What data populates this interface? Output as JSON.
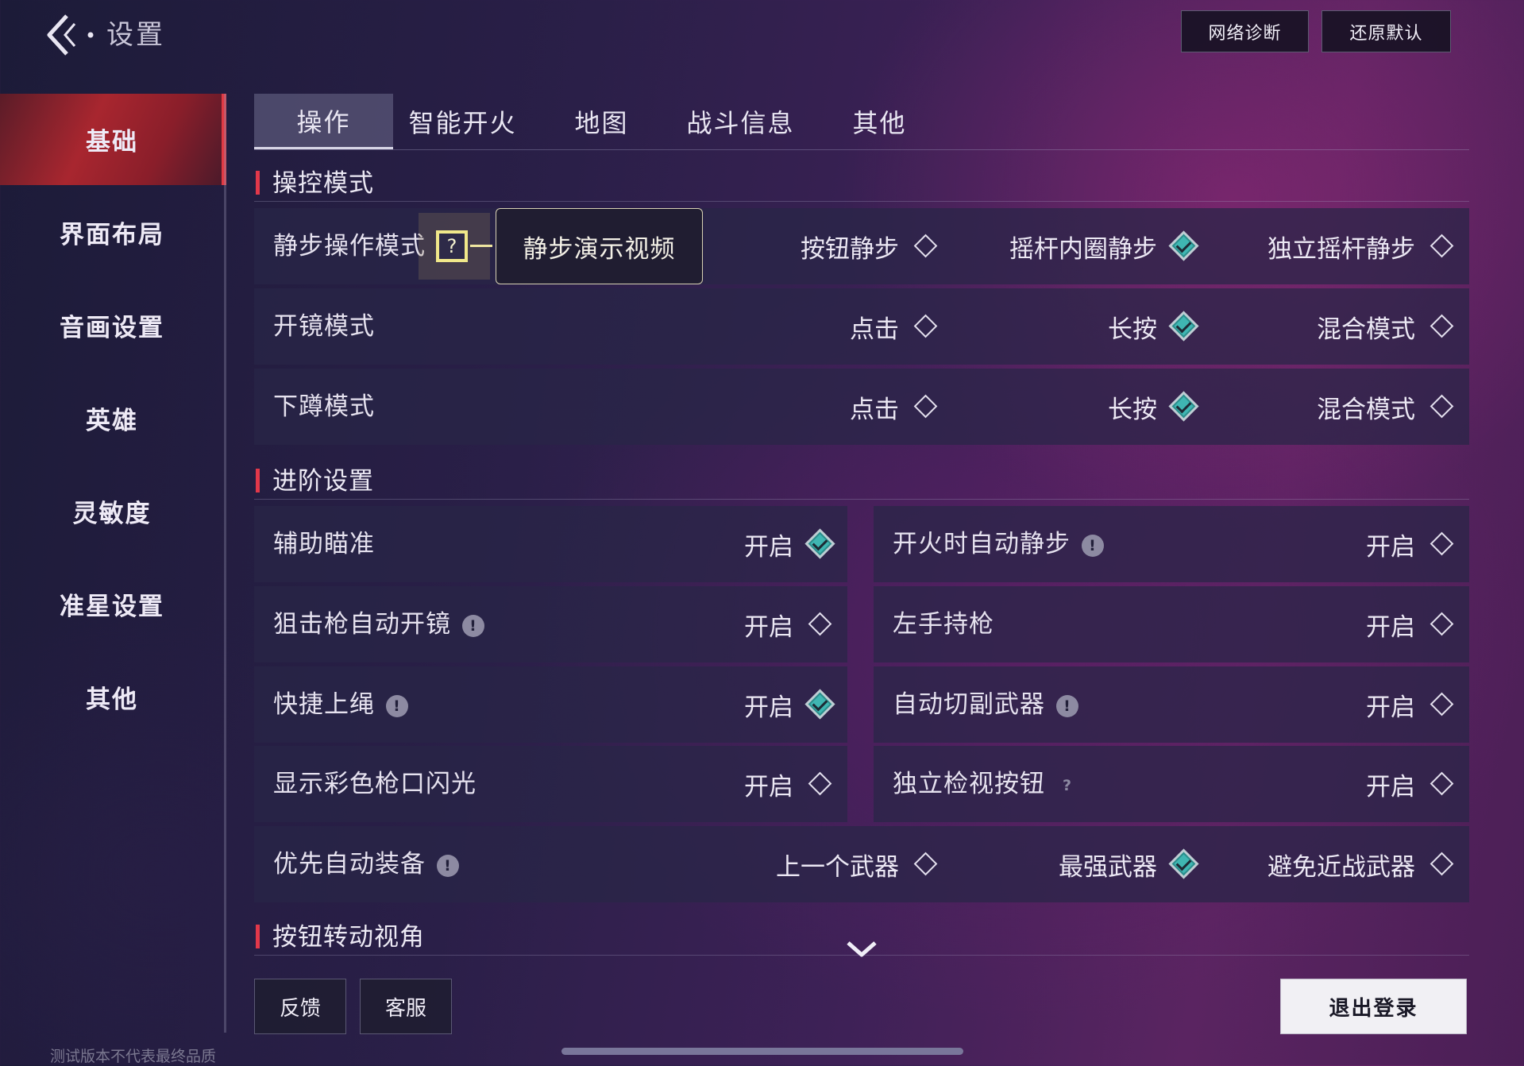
{
  "header": {
    "title": "设置",
    "network_button": "网络诊断",
    "reset_button": "还原默认"
  },
  "sidebar": {
    "items": [
      {
        "label": "基础",
        "active": true
      },
      {
        "label": "界面布局"
      },
      {
        "label": "音画设置"
      },
      {
        "label": "英雄"
      },
      {
        "label": "灵敏度"
      },
      {
        "label": "准星设置"
      },
      {
        "label": "其他"
      }
    ]
  },
  "tabs": [
    {
      "label": "操作",
      "active": true
    },
    {
      "label": "智能开火"
    },
    {
      "label": "地图"
    },
    {
      "label": "战斗信息"
    },
    {
      "label": "其他"
    }
  ],
  "control_mode": {
    "title": "操控模式",
    "rows": [
      {
        "label": "静步操作模式",
        "help": "?",
        "video_button": "静步演示视频",
        "options": [
          "按钮静步",
          "摇杆内圈静步",
          "独立摇杆静步"
        ],
        "selected": 1
      },
      {
        "label": "开镜模式",
        "options": [
          "点击",
          "长按",
          "混合模式"
        ],
        "selected": 1
      },
      {
        "label": "下蹲模式",
        "options": [
          "点击",
          "长按",
          "混合模式"
        ],
        "selected": 1
      }
    ]
  },
  "advanced": {
    "title": "进阶设置",
    "left": [
      {
        "label": "辅助瞄准",
        "option": "开启",
        "checked": true
      },
      {
        "label": "狙击枪自动开镜",
        "badge": "!",
        "option": "开启",
        "checked": false
      },
      {
        "label": "快捷上绳",
        "badge": "!",
        "option": "开启",
        "checked": true
      },
      {
        "label": "显示彩色枪口闪光",
        "option": "开启",
        "checked": false
      }
    ],
    "right": [
      {
        "label": "开火时自动静步",
        "badge": "!",
        "option": "开启",
        "checked": false
      },
      {
        "label": "左手持枪",
        "option": "开启",
        "checked": false
      },
      {
        "label": "自动切副武器",
        "badge": "!",
        "option": "开启",
        "checked": false
      },
      {
        "label": "独立检视按钮",
        "badge": "?",
        "option": "开启",
        "checked": false
      }
    ],
    "auto_equip": {
      "label": "优先自动装备",
      "badge": "!",
      "options": [
        "上一个武器",
        "最强武器",
        "避免近战武器"
      ],
      "selected": 1
    }
  },
  "camera_section": {
    "title": "按钮转动视角"
  },
  "footer": {
    "feedback_button": "反馈",
    "service_button": "客服",
    "logout_button": "退出登录",
    "version_note": "测试版本不代表最终品质"
  },
  "colors": {
    "accent_red": "#e2384a",
    "selected_teal": "#3fb6b2",
    "highlight_yellow": "#f1e88a"
  },
  "icons": {
    "back": "chevron-left-icon",
    "selected": "diamond-check-icon",
    "unselected": "diamond-outline-icon",
    "info": "exclamation-icon",
    "help": "question-icon",
    "scroll": "chevron-down-icon"
  }
}
